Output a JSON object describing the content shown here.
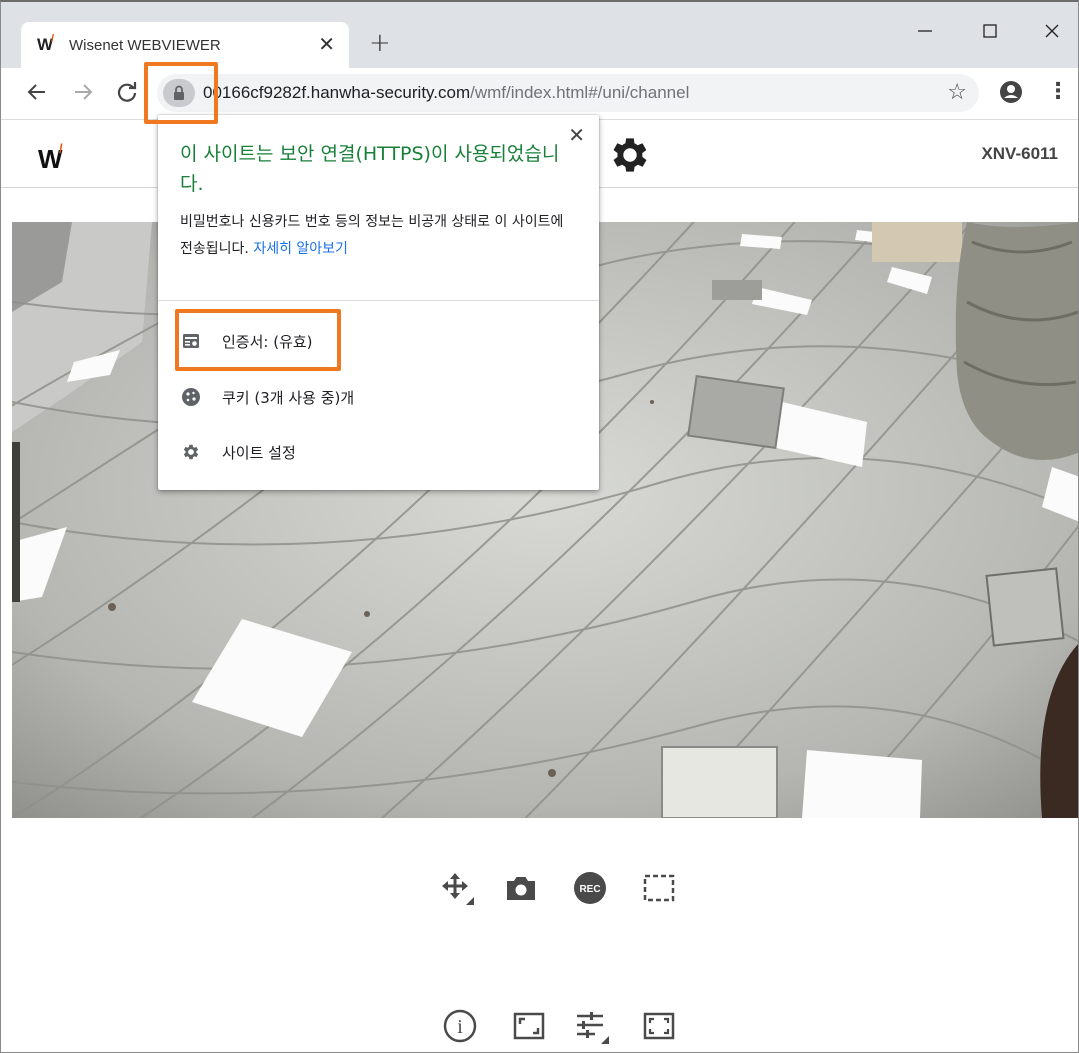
{
  "browser": {
    "tab": {
      "title": "Wisenet WEBVIEWER",
      "favicon": "W",
      "close_label": "✕"
    },
    "new_tab_label": "+",
    "window_controls": {
      "minimize": "—",
      "maximize": "☐",
      "close": "✕"
    },
    "nav": {
      "back": "←",
      "forward": "→",
      "reload": "C"
    },
    "url": {
      "host": "00166cf9282f.hanwha-security.com",
      "path": "/wmf/index.html#/uni/channel"
    },
    "bookmark_star": "☆",
    "menu_dots": "⋮"
  },
  "app": {
    "logo": "W",
    "model": "XNV-6011"
  },
  "popup": {
    "title": "이 사이트는 보안 연결(HTTPS)이 사용되었습니다.",
    "description": "비밀번호나 신용카드 번호 등의 정보는 비공개 상태로 이 사이트에 전송됩니다.",
    "learn_more": "자세히 알아보기",
    "close_label": "✕",
    "items": [
      {
        "label": "인증서: (유효)",
        "icon": "certificate-icon"
      },
      {
        "label": "쿠키 (3개 사용 중)개",
        "icon": "cookie-icon"
      },
      {
        "label": "사이트 설정",
        "icon": "gear-icon"
      }
    ]
  },
  "controls": {
    "row1": [
      "ptz-move-icon",
      "snapshot-camera-icon",
      "record-icon",
      "area-select-icon"
    ],
    "rec_label": "REC",
    "row2": [
      "info-icon",
      "aspect-fit-icon",
      "settings-sliders-icon",
      "fullscreen-icon"
    ],
    "info_label": "i"
  },
  "colors": {
    "highlight": "#f07820",
    "secure_green": "#188038",
    "link_blue": "#1a73e8",
    "brand_orange": "#e35205"
  }
}
